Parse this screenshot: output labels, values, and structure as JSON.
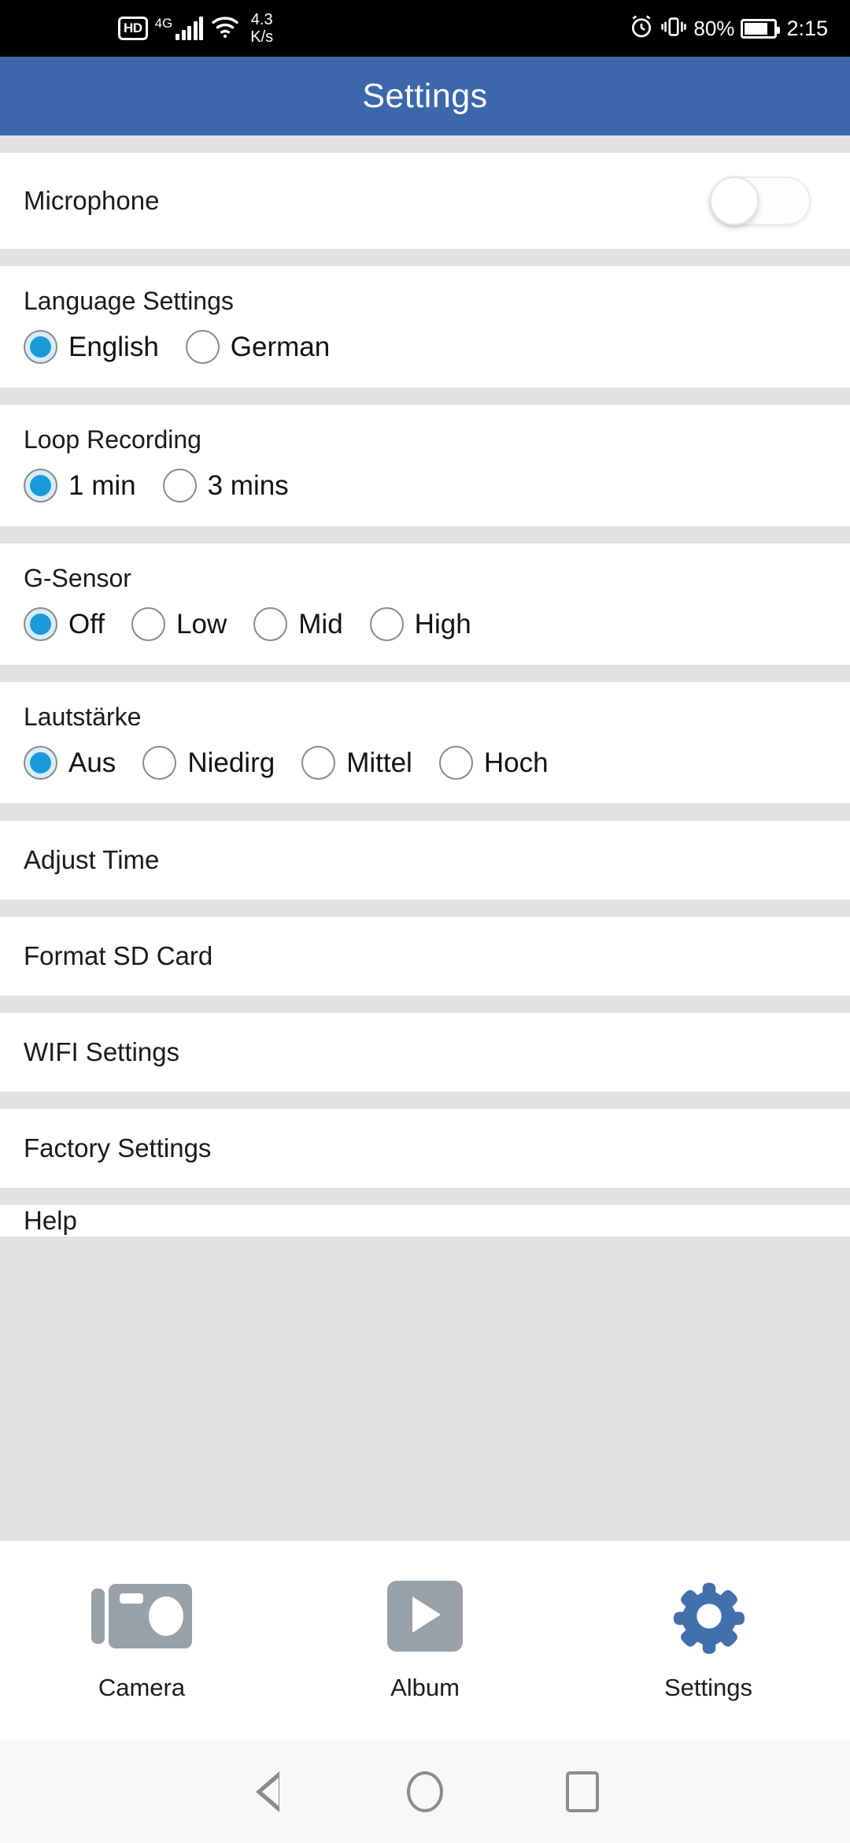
{
  "status_bar": {
    "hd_badge": "HD",
    "network_type": "4G",
    "data_speed_value": "4.3",
    "data_speed_unit": "K/s",
    "battery_percent": "80%",
    "clock": "2:15",
    "icons": [
      "hd-icon",
      "signal-icon",
      "wifi-icon",
      "alarm-icon",
      "vibrate-icon",
      "battery-icon"
    ]
  },
  "header": {
    "title": "Settings",
    "background": "#3c67ab"
  },
  "microphone": {
    "label": "Microphone",
    "state": "off"
  },
  "sections": [
    {
      "title": "Language Settings",
      "options": [
        {
          "label": "English",
          "selected": true
        },
        {
          "label": "German",
          "selected": false
        }
      ]
    },
    {
      "title": "Loop Recording",
      "options": [
        {
          "label": "1 min",
          "selected": true
        },
        {
          "label": "3 mins",
          "selected": false
        }
      ]
    },
    {
      "title": "G-Sensor",
      "options": [
        {
          "label": "Off",
          "selected": true
        },
        {
          "label": "Low",
          "selected": false
        },
        {
          "label": "Mid",
          "selected": false
        },
        {
          "label": "High",
          "selected": false
        }
      ]
    },
    {
      "title": "Lautstärke",
      "options": [
        {
          "label": "Aus",
          "selected": true
        },
        {
          "label": "Niedirg",
          "selected": false
        },
        {
          "label": "Mittel",
          "selected": false
        },
        {
          "label": "Hoch",
          "selected": false
        }
      ]
    }
  ],
  "list_items": [
    {
      "label": "Adjust Time"
    },
    {
      "label": "Format SD Card"
    },
    {
      "label": "WIFI Settings"
    },
    {
      "label": "Factory Settings"
    },
    {
      "label": "Help"
    }
  ],
  "tab_bar": {
    "tabs": [
      {
        "label": "Camera",
        "icon": "camera-icon",
        "active": false
      },
      {
        "label": "Album",
        "icon": "play-icon",
        "active": false
      },
      {
        "label": "Settings",
        "icon": "gear-icon",
        "active": true
      }
    ],
    "inactive_color": "#9aa0a8",
    "active_color": "#4270ad"
  },
  "nav_bar": {
    "buttons": [
      "back-icon",
      "home-icon",
      "recents-icon"
    ]
  },
  "colors": {
    "accent_blue": "#3c67ab",
    "radio_selected": "#1a9bd7",
    "divider_gray": "#e2e2e2",
    "text_primary": "#1a1a1a"
  }
}
